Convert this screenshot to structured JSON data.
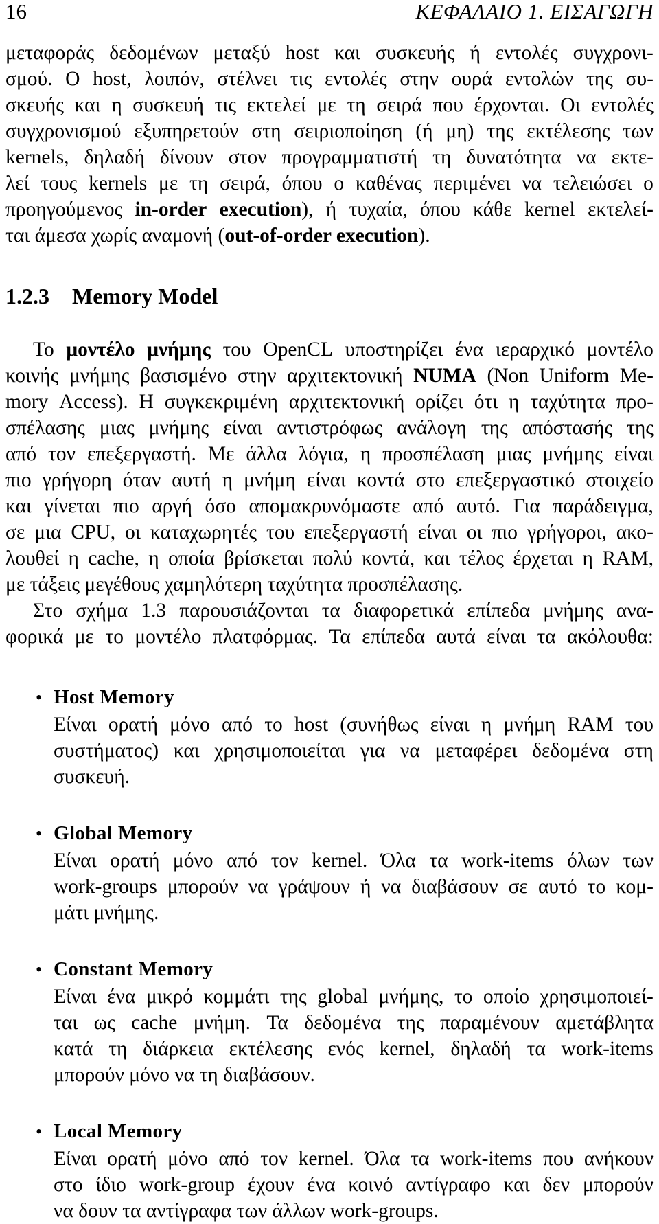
{
  "header": {
    "folio": "16",
    "chapter_title": "ΚΕΦΑΛΑΙΟ 1.  ΕΙΣΑΓΩΓΗ"
  },
  "paragraph1": {
    "lines": [
      "μεταφοράς δεδομένων μεταξύ host και συσκευής ή εντολές συγχρονι-",
      "σμού. Ο host, λοιπόν, στέλνει τις εντολές στην ουρά εντολών της συ-",
      "σκευής και η συσκευή τις εκτελεί με τη σειρά που έρχονται. Οι εντολές",
      "συγχρονισμού εξυπηρετούν στη σειριοποίηση (ή μη) της εκτέλεσης των",
      "kernels, δηλαδή δίνουν στον προγραμματιστή τη δυνατότητα να εκτε-",
      "λεί τους kernels με τη σειρά, όπου ο καθένας περιμένει να τελειώσει ο",
      "προηγούμενος (in-order execution), ή τυχαία, όπου κάθε kernel εκτελεί-",
      "ται άμεσα χωρίς αναμονή (out-of-order execution)."
    ],
    "bold_spans": [
      "in-order execution",
      "out-of-order execution"
    ]
  },
  "section": {
    "number": "1.2.3",
    "title": "Memory Model"
  },
  "paragraph2": {
    "lines": [
      "Το μοντέλο μνήμης του OpenCL υποστηρίζει ένα ιεραρχικό μοντέλο",
      "κοινής μνήμης βασισμένο στην αρχιτεκτονική NUMA (Non Uniform Me-",
      "mory Access). Η συγκεκριμένη αρχιτεκτονική ορίζει ότι η ταχύτητα προ-",
      "σπέλασης μιας μνήμης είναι αντιστρόφως ανάλογη της απόστασής της",
      "από τον επεξεργαστή. Με άλλα λόγια, η προσπέλαση μιας μνήμης είναι",
      "πιο γρήγορη όταν αυτή η μνήμη είναι κοντά στο επεξεργαστικό στοιχείο",
      "και γίνεται πιο αργή όσο απομακρυνόμαστε από αυτό. Για παράδειγμα,",
      "σε μια CPU, οι καταχωρητές του επεξεργαστή είναι οι πιο γρήγοροι, ακο-",
      "λουθεί η cache, η οποία βρίσκεται πολύ κοντά, και τέλος έρχεται η RAM,",
      "με τάξεις μεγέθους χαμηλότερη ταχύτητα προσπέλασης."
    ],
    "bold_spans": [
      "μοντέλο μνήμης",
      "NUMA"
    ]
  },
  "paragraph3": {
    "lines": [
      "Στο σχήμα 1.3 παρουσιάζονται τα διαφορετικά επίπεδα μνήμης ανα-",
      "φορικά με το μοντέλο πλατφόρμας. Τα επίπεδα αυτά είναι τα ακόλουθα:"
    ]
  },
  "bullets": [
    {
      "marker": "•",
      "term": "Host Memory",
      "lines": [
        "Είναι ορατή μόνο από το host (συνήθως είναι η μνήμη RAM του",
        "συστήματος) και χρησιμοποιείται για να μεταφέρει δεδομένα στη",
        "συσκευή."
      ]
    },
    {
      "marker": "•",
      "term": "Global Memory",
      "lines": [
        "Είναι ορατή μόνο από τον kernel. Όλα τα work-items όλων των",
        "work-groups μπορούν να γράψουν ή να διαβάσουν σε αυτό το κομ-",
        "μάτι μνήμης."
      ]
    },
    {
      "marker": "•",
      "term": "Constant Memory",
      "lines": [
        "Είναι ένα μικρό κομμάτι της global μνήμης, το οποίο χρησιμοποιεί-",
        "ται ως cache μνήμη. Τα δεδομένα της παραμένουν αμετάβλητα",
        "κατά τη διάρκεια εκτέλεσης ενός kernel, δηλαδή τα work-items",
        "μπορούν μόνο να τη διαβάσουν."
      ]
    },
    {
      "marker": "•",
      "term": "Local Memory",
      "lines": [
        "Είναι ορατή μόνο από τον kernel. Όλα τα work-items που ανήκουν",
        "στο ίδιο work-group έχουν ένα κοινό αντίγραφο και δεν μπορούν",
        "να δουν τα αντίγραφα των άλλων work-groups."
      ]
    }
  ]
}
